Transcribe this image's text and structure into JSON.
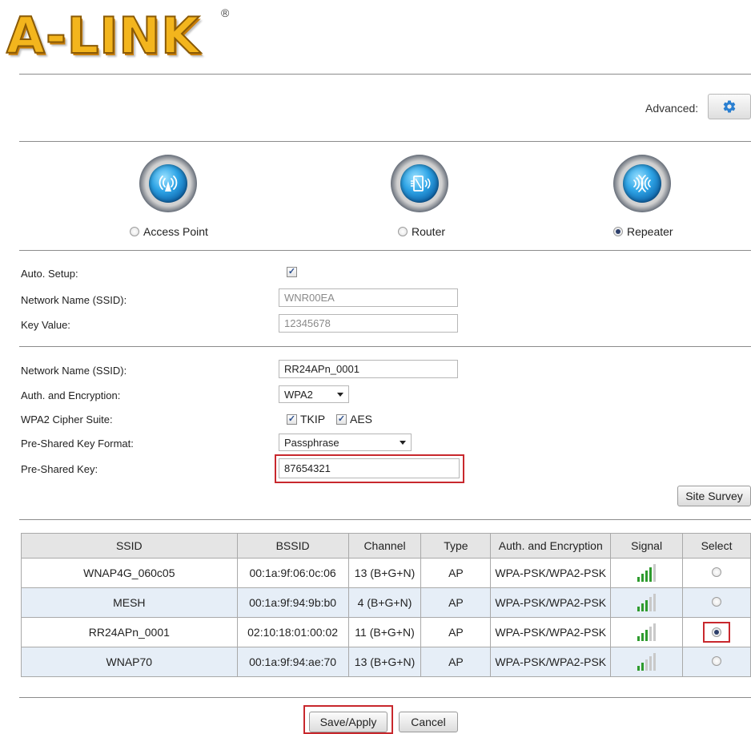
{
  "brand": {
    "logo_text": "A-LINK",
    "registered": "®"
  },
  "advanced": {
    "label": "Advanced:",
    "icon": "gear-icon"
  },
  "modes": [
    {
      "label": "Access Point",
      "icon": "access-point-icon",
      "selected": false
    },
    {
      "label": "Router",
      "icon": "router-icon",
      "selected": false
    },
    {
      "label": "Repeater",
      "icon": "repeater-icon",
      "selected": true
    }
  ],
  "auto_setup": {
    "label": "Auto. Setup:",
    "checked": true,
    "ssid_label": "Network Name (SSID):",
    "ssid_value": "WNR00EA",
    "key_label": "Key Value:",
    "key_value": "12345678"
  },
  "wireless": {
    "ssid_label": "Network Name (SSID):",
    "ssid_value": "RR24APn_0001",
    "auth_label": "Auth. and Encryption:",
    "auth_value": "WPA2",
    "cipher_label": "WPA2 Cipher Suite:",
    "cipher_tkip": "TKIP",
    "cipher_aes": "AES",
    "psk_format_label": "Pre-Shared Key Format:",
    "psk_format_value": "Passphrase",
    "psk_label": "Pre-Shared Key:",
    "psk_value": "87654321"
  },
  "site_survey_label": "Site Survey",
  "table": {
    "headers": [
      "SSID",
      "BSSID",
      "Channel",
      "Type",
      "Auth. and Encryption",
      "Signal",
      "Select"
    ],
    "rows": [
      {
        "ssid": "WNAP4G_060c05",
        "bssid": "00:1a:9f:06:0c:06",
        "channel": "13 (B+G+N)",
        "type": "AP",
        "auth": "WPA-PSK/WPA2-PSK",
        "signal": 4,
        "selected": false
      },
      {
        "ssid": "MESH",
        "bssid": "00:1a:9f:94:9b:b0",
        "channel": "4 (B+G+N)",
        "type": "AP",
        "auth": "WPA-PSK/WPA2-PSK",
        "signal": 3,
        "selected": false
      },
      {
        "ssid": "RR24APn_0001",
        "bssid": "02:10:18:01:00:02",
        "channel": "11 (B+G+N)",
        "type": "AP",
        "auth": "WPA-PSK/WPA2-PSK",
        "signal": 3,
        "selected": true
      },
      {
        "ssid": "WNAP70",
        "bssid": "00:1a:9f:94:ae:70",
        "channel": "13 (B+G+N)",
        "type": "AP",
        "auth": "WPA-PSK/WPA2-PSK",
        "signal": 2,
        "selected": false
      }
    ]
  },
  "buttons": {
    "save": "Save/Apply",
    "cancel": "Cancel"
  },
  "colors": {
    "highlight": "#c8282d",
    "signal_on": "#2e9b2e",
    "signal_off": "#c9c9c9",
    "row_alt": "#e6eef7",
    "header_bg": "#e5e5e5"
  }
}
